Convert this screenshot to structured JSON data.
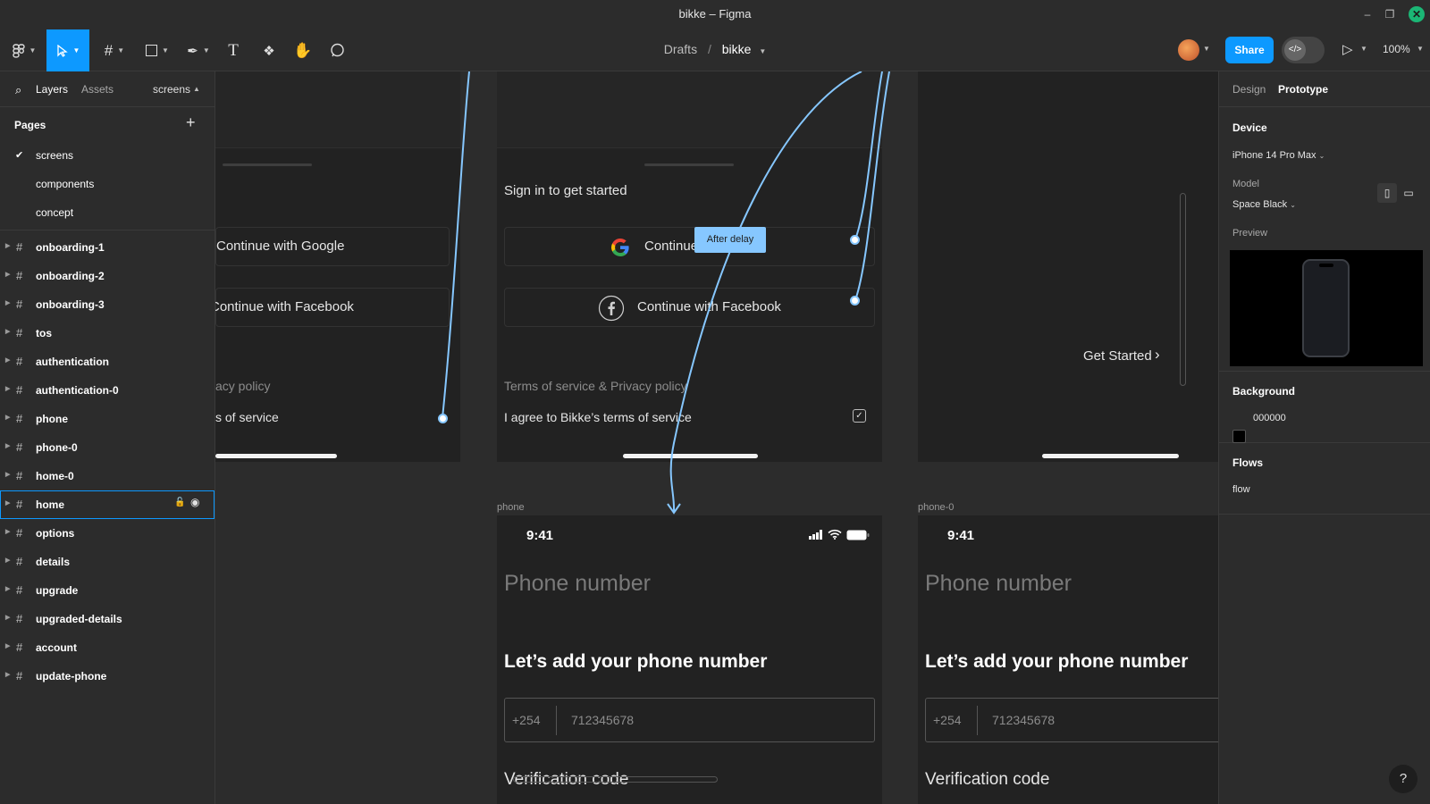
{
  "window": {
    "title": "bikke – Figma"
  },
  "toolbar": {
    "breadcrumb_folder": "Drafts",
    "breadcrumb_file": "bikke",
    "share_label": "Share",
    "zoom": "100%"
  },
  "left_panel": {
    "tab_layers": "Layers",
    "tab_assets": "Assets",
    "current_page_dropdown": "screens",
    "pages_header": "Pages",
    "pages": [
      "screens",
      "components",
      "concept"
    ],
    "layers": [
      "onboarding-1",
      "onboarding-2",
      "onboarding-3",
      "tos",
      "authentication",
      "authentication-0",
      "phone",
      "phone-0",
      "home-0",
      "home",
      "options",
      "details",
      "upgrade",
      "upgraded-details",
      "account",
      "update-phone"
    ],
    "selected_layer": "home"
  },
  "canvas": {
    "frame_a": {
      "google_btn": "Continue with Google",
      "facebook_btn": "Continue with Facebook",
      "policy_fragment": "acy policy",
      "tos_fragment": "s of service"
    },
    "frame_b": {
      "heading": "Sign in to get started",
      "google_btn": "Continue w",
      "facebook_btn": "Continue with Facebook",
      "policy": "Terms of service & Privacy policy",
      "agree": "I agree to Bikke’s terms of service"
    },
    "frame_c": {
      "get_started": "Get Started"
    },
    "interaction_tag": "After delay",
    "phone_frame": {
      "label": "phone",
      "time": "9:41",
      "title": "Phone number",
      "heading": "Let’s add your phone number",
      "country_code": "+254",
      "number": "712345678",
      "verification": "Verification code"
    },
    "phone0_frame": {
      "label": "phone-0",
      "time": "9:41",
      "title": "Phone number",
      "heading": "Let’s add your phone number",
      "country_code": "+254",
      "number": "712345678",
      "verification": "Verification code"
    }
  },
  "right_panel": {
    "tab_design": "Design",
    "tab_prototype": "Prototype",
    "device_header": "Device",
    "device_value": "iPhone 14 Pro Max",
    "model_label": "Model",
    "model_value": "Space Black",
    "preview_label": "Preview",
    "background_header": "Background",
    "background_value": "000000",
    "flows_header": "Flows",
    "flow_item": "flow"
  },
  "help": "?"
}
